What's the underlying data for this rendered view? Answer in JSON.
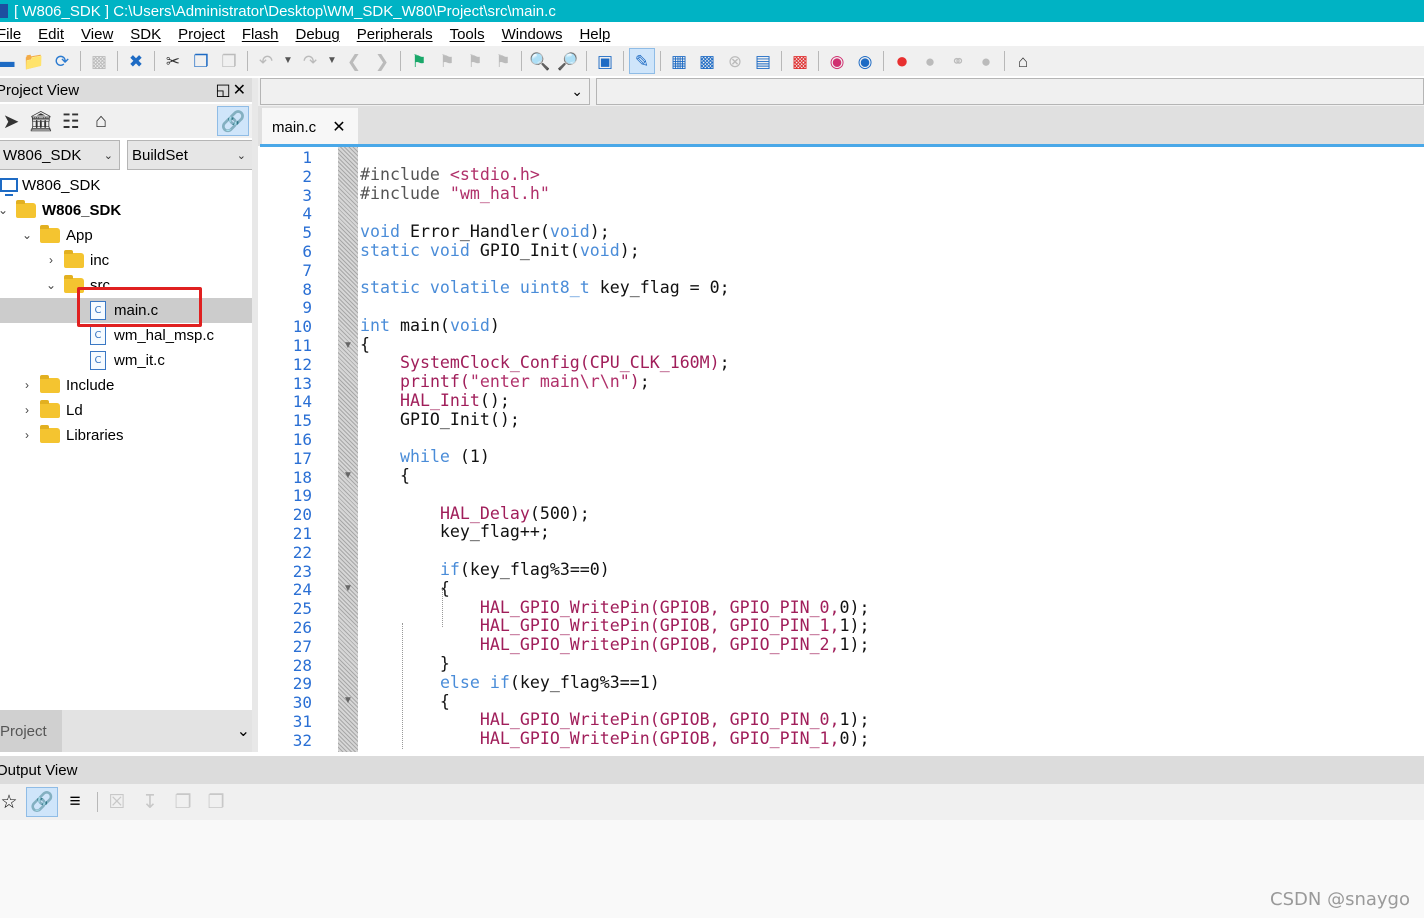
{
  "window": {
    "title": "[ W806_SDK ] C:\\Users\\Administrator\\Desktop\\WM_SDK_W80\\Project\\src\\main.c"
  },
  "menu": [
    "File",
    "Edit",
    "View",
    "SDK",
    "Project",
    "Flash",
    "Debug",
    "Peripherals",
    "Tools",
    "Windows",
    "Help"
  ],
  "project_view": {
    "title": "Project View",
    "target_select": "W806_SDK",
    "build_select": "BuildSet",
    "tree": {
      "root": "W806_SDK",
      "project": "W806_SDK",
      "app": "App",
      "inc": "inc",
      "src": "src",
      "files": [
        "main.c",
        "wm_hal_msp.c",
        "wm_it.c"
      ],
      "include": "Include",
      "ld": "Ld",
      "libraries": "Libraries"
    },
    "footer_tab": "Project"
  },
  "editor": {
    "tab_label": "main.c",
    "first_line": 1,
    "line_count": 32
  },
  "output_view": {
    "title": "Output View"
  },
  "watermark": "CSDN @snaygo",
  "colors": {
    "titlebar": "#00b3c4",
    "keyword": "#4a8cd8",
    "function": "#a01e5a",
    "highlight_box": "#e02020"
  }
}
